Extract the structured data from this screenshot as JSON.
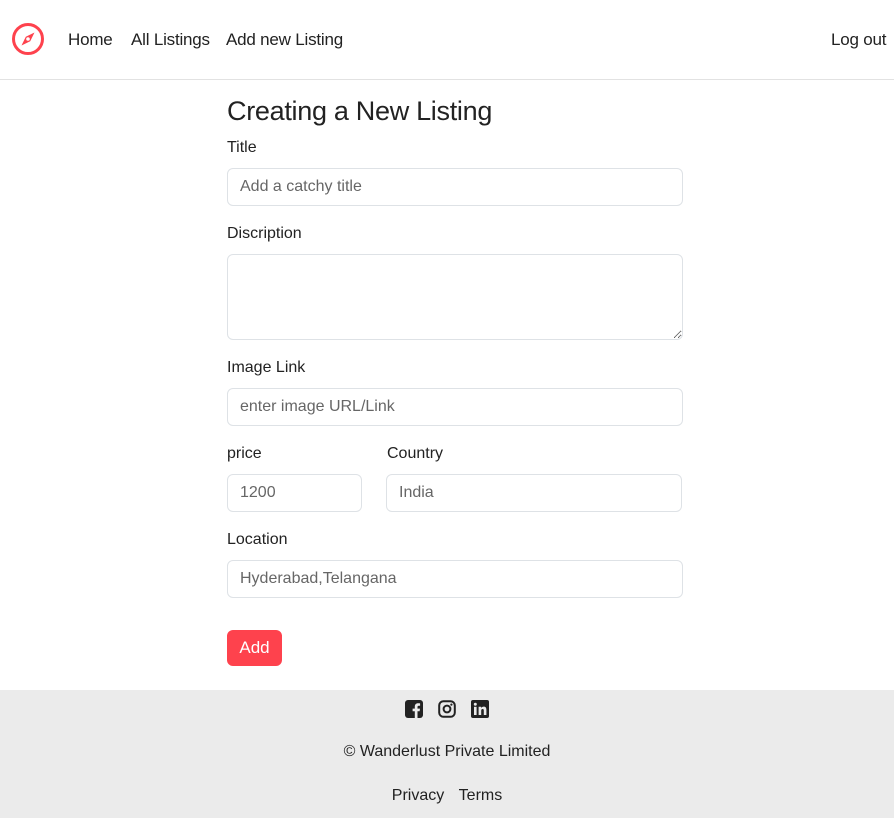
{
  "nav": {
    "brand_icon": "compass-icon",
    "brand_color": "#fe424d",
    "links": [
      "Home",
      "All Listings",
      "Add new Listing"
    ],
    "logout": "Log out"
  },
  "form": {
    "heading": "Creating a New Listing",
    "title_label": "Title",
    "title_placeholder": "Add a catchy title",
    "description_label": "Discription",
    "description_value": "",
    "image_label": "Image Link",
    "image_placeholder": "enter image URL/Link",
    "price_label": "price",
    "price_placeholder": "1200",
    "country_label": "Country",
    "country_placeholder": "India",
    "location_label": "Location",
    "location_placeholder": "Hyderabad,Telangana",
    "submit_label": "Add",
    "submit_color": "#fe424d"
  },
  "footer": {
    "socials": [
      "facebook-icon",
      "instagram-icon",
      "linkedin-icon"
    ],
    "copyright": "© Wanderlust Private Limited",
    "links": [
      "Privacy",
      "Terms"
    ],
    "background": "#ebebeb"
  }
}
